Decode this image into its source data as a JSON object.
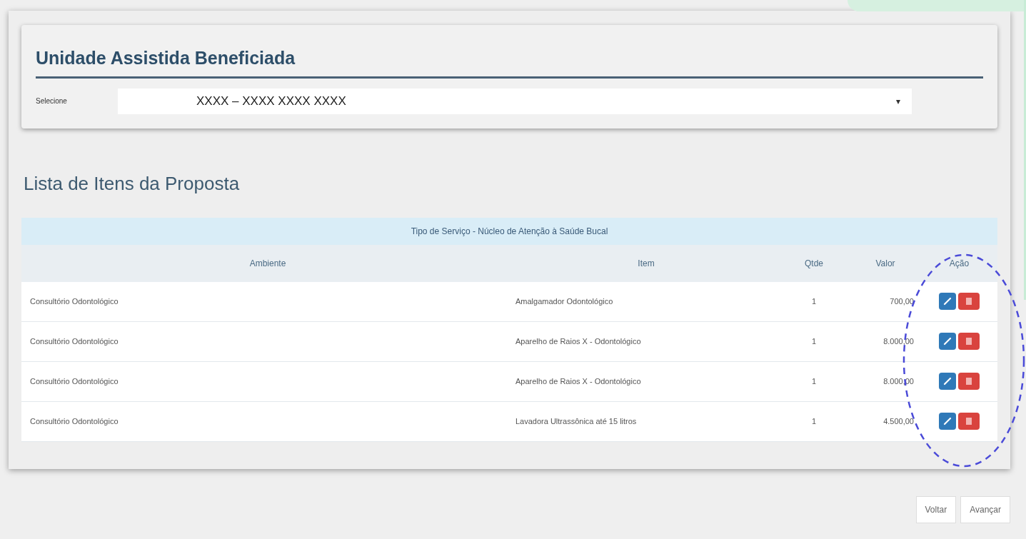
{
  "unit_section": {
    "title": "Unidade Assistida Beneficiada",
    "select_label": "Selecione",
    "select_value": "XXXX – XXXX XXXX XXXX",
    "caret": "▾"
  },
  "list_title": "Lista de Itens da Proposta",
  "table": {
    "group_header": "Tipo de Serviço - Núcleo de Atenção à Saúde Bucal",
    "columns": [
      "Ambiente",
      "Item",
      "Qtde",
      "Valor",
      "Ação"
    ],
    "rows": [
      {
        "ambiente": "Consultório Odontológico",
        "item": "Amalgamador Odontológico",
        "qtde": "1",
        "valor": "700,00"
      },
      {
        "ambiente": "Consultório Odontológico",
        "item": "Aparelho de Raios X - Odontológico",
        "qtde": "1",
        "valor": "8.000,00"
      },
      {
        "ambiente": "Consultório Odontológico",
        "item": "Aparelho de Raios X - Odontológico",
        "qtde": "1",
        "valor": "8.000,00"
      },
      {
        "ambiente": "Consultório Odontológico",
        "item": "Lavadora Ultrassônica até 15 litros",
        "qtde": "1",
        "valor": "4.500,00"
      }
    ]
  },
  "buttons": [
    "Voltar",
    "Avançar"
  ]
}
